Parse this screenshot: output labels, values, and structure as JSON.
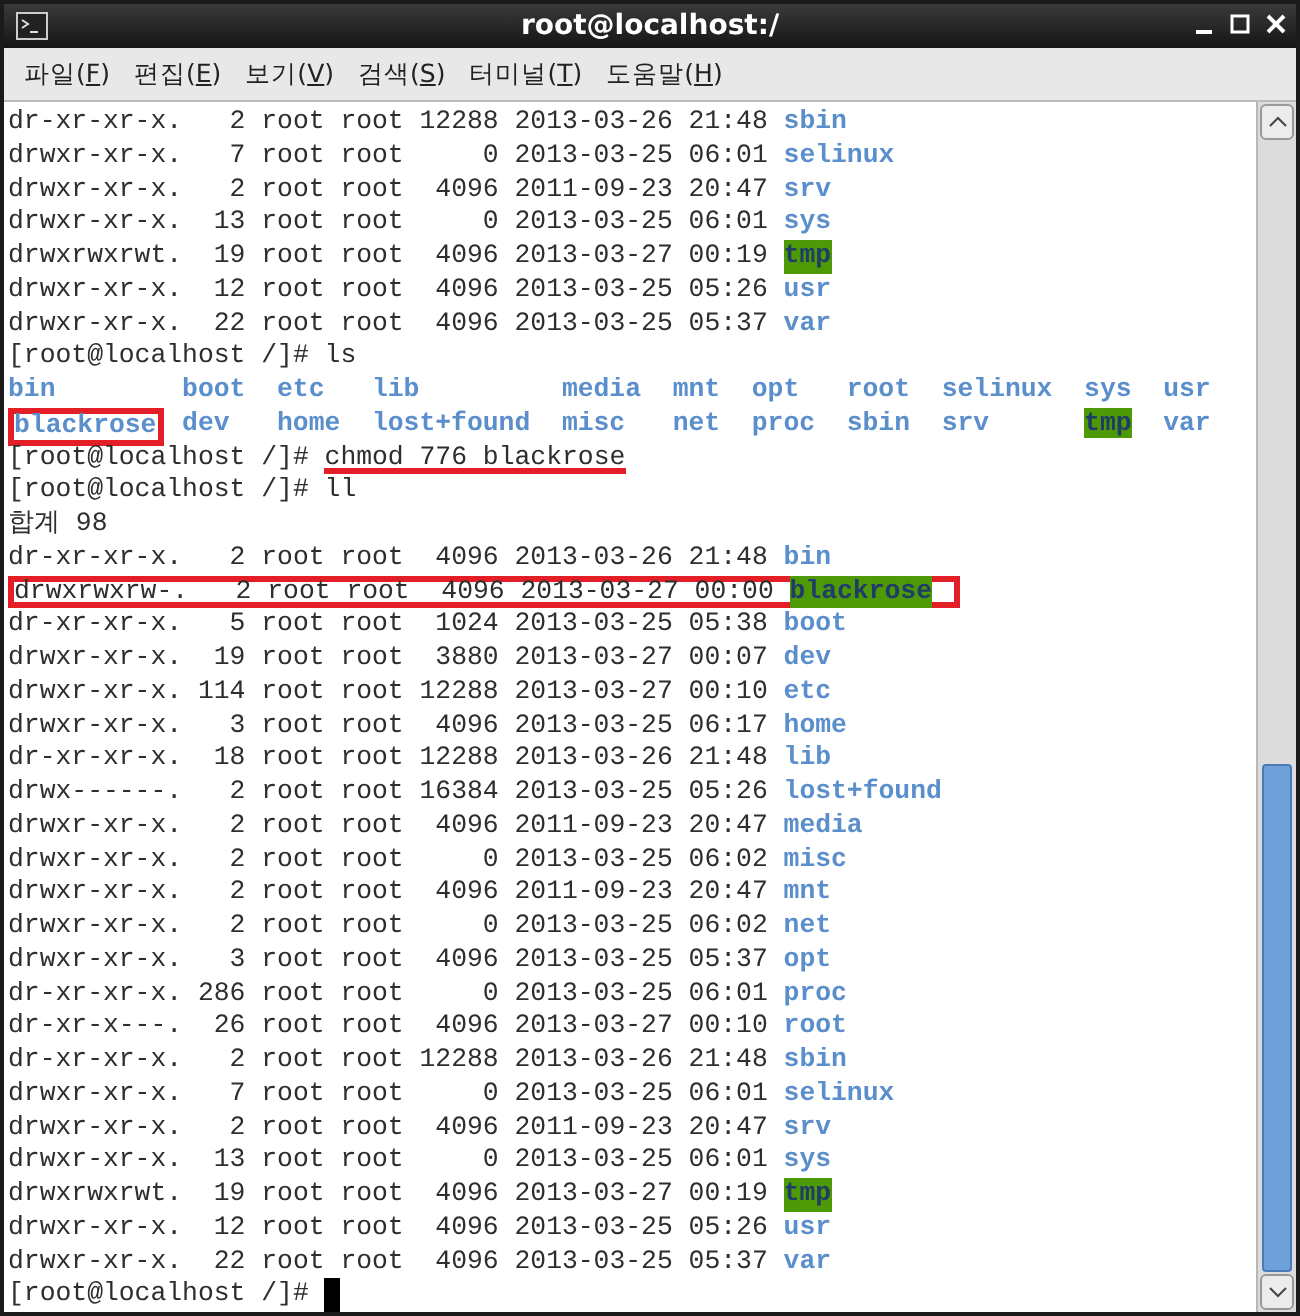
{
  "window": {
    "title": "root@localhost:/"
  },
  "menu": [
    {
      "prefix": "파일(",
      "key": "F",
      "suffix": ")"
    },
    {
      "prefix": "편집(",
      "key": "E",
      "suffix": ")"
    },
    {
      "prefix": "보기(",
      "key": "V",
      "suffix": ")"
    },
    {
      "prefix": "검색(",
      "key": "S",
      "suffix": ")"
    },
    {
      "prefix": "터미널(",
      "key": "T",
      "suffix": ")"
    },
    {
      "prefix": "도움말(",
      "key": "H",
      "suffix": ")"
    }
  ],
  "terminal": {
    "lines": [
      {
        "kind": "entry",
        "text": "dr-xr-xr-x.   2 root root 12288 2013-03-26 21:48",
        "name": "sbin",
        "highlighted": false,
        "boxed": false
      },
      {
        "kind": "entry",
        "text": "drwxr-xr-x.   7 root root     0 2013-03-25 06:01",
        "name": "selinux",
        "highlighted": false,
        "boxed": false
      },
      {
        "kind": "entry",
        "text": "drwxr-xr-x.   2 root root  4096 2011-09-23 20:47",
        "name": "srv",
        "highlighted": false,
        "boxed": false
      },
      {
        "kind": "entry",
        "text": "drwxr-xr-x.  13 root root     0 2013-03-25 06:01",
        "name": "sys",
        "highlighted": false,
        "boxed": false
      },
      {
        "kind": "entry",
        "text": "drwxrwxrwt.  19 root root  4096 2013-03-27 00:19",
        "name": "tmp",
        "highlighted": true,
        "boxed": false
      },
      {
        "kind": "entry",
        "text": "drwxr-xr-x.  12 root root  4096 2013-03-25 05:26",
        "name": "usr",
        "highlighted": false,
        "boxed": false
      },
      {
        "kind": "entry",
        "text": "drwxr-xr-x.  22 root root  4096 2013-03-25 05:37",
        "name": "var",
        "highlighted": false,
        "boxed": false
      },
      {
        "kind": "prompt",
        "prompt": "[root@localhost /]#",
        "command": "ls"
      },
      {
        "kind": "ls_row",
        "items": [
          {
            "name": "bin",
            "highlighted": false,
            "boxed": false
          },
          {
            "name": "boot",
            "highlighted": false,
            "boxed": false
          },
          {
            "name": "etc",
            "highlighted": false,
            "boxed": false
          },
          {
            "name": "lib",
            "highlighted": false,
            "boxed": false
          },
          {
            "name": "media",
            "highlighted": false,
            "boxed": false
          },
          {
            "name": "mnt",
            "highlighted": false,
            "boxed": false
          },
          {
            "name": "opt",
            "highlighted": false,
            "boxed": false
          },
          {
            "name": "root",
            "highlighted": false,
            "boxed": false
          },
          {
            "name": "selinux",
            "highlighted": false,
            "boxed": false
          },
          {
            "name": "sys",
            "highlighted": false,
            "boxed": false
          },
          {
            "name": "usr",
            "highlighted": false,
            "boxed": false
          }
        ]
      },
      {
        "kind": "ls_row",
        "items": [
          {
            "name": "blackrose",
            "highlighted": false,
            "boxed": true
          },
          {
            "name": "dev",
            "highlighted": false,
            "boxed": false
          },
          {
            "name": "home",
            "highlighted": false,
            "boxed": false
          },
          {
            "name": "lost+found",
            "highlighted": false,
            "boxed": false
          },
          {
            "name": "misc",
            "highlighted": false,
            "boxed": false
          },
          {
            "name": "net",
            "highlighted": false,
            "boxed": false
          },
          {
            "name": "proc",
            "highlighted": false,
            "boxed": false
          },
          {
            "name": "sbin",
            "highlighted": false,
            "boxed": false
          },
          {
            "name": "srv",
            "highlighted": false,
            "boxed": false
          },
          {
            "name": "tmp",
            "highlighted": true,
            "boxed": false
          },
          {
            "name": "var",
            "highlighted": false,
            "boxed": false
          }
        ]
      },
      {
        "kind": "prompt",
        "prompt": "[root@localhost /]#",
        "command": "chmod 776 blackrose",
        "underlined": true
      },
      {
        "kind": "prompt",
        "prompt": "[root@localhost /]#",
        "command": "ll"
      },
      {
        "kind": "text",
        "text": "합계 98"
      },
      {
        "kind": "entry",
        "text": "dr-xr-xr-x.   2 root root  4096 2013-03-26 21:48",
        "name": "bin",
        "highlighted": false,
        "boxed": false
      },
      {
        "kind": "entry",
        "text": "drwxrwxrw-.   2 root root  4096 2013-03-27 00:00",
        "name": "blackrose",
        "highlighted": true,
        "boxed": true
      },
      {
        "kind": "entry",
        "text": "dr-xr-xr-x.   5 root root  1024 2013-03-25 05:38",
        "name": "boot",
        "highlighted": false,
        "boxed": false
      },
      {
        "kind": "entry",
        "text": "drwxr-xr-x.  19 root root  3880 2013-03-27 00:07",
        "name": "dev",
        "highlighted": false,
        "boxed": false
      },
      {
        "kind": "entry",
        "text": "drwxr-xr-x. 114 root root 12288 2013-03-27 00:10",
        "name": "etc",
        "highlighted": false,
        "boxed": false
      },
      {
        "kind": "entry",
        "text": "drwxr-xr-x.   3 root root  4096 2013-03-25 06:17",
        "name": "home",
        "highlighted": false,
        "boxed": false
      },
      {
        "kind": "entry",
        "text": "dr-xr-xr-x.  18 root root 12288 2013-03-26 21:48",
        "name": "lib",
        "highlighted": false,
        "boxed": false
      },
      {
        "kind": "entry",
        "text": "drwx------.   2 root root 16384 2013-03-25 05:26",
        "name": "lost+found",
        "highlighted": false,
        "boxed": false
      },
      {
        "kind": "entry",
        "text": "drwxr-xr-x.   2 root root  4096 2011-09-23 20:47",
        "name": "media",
        "highlighted": false,
        "boxed": false
      },
      {
        "kind": "entry",
        "text": "drwxr-xr-x.   2 root root     0 2013-03-25 06:02",
        "name": "misc",
        "highlighted": false,
        "boxed": false
      },
      {
        "kind": "entry",
        "text": "drwxr-xr-x.   2 root root  4096 2011-09-23 20:47",
        "name": "mnt",
        "highlighted": false,
        "boxed": false
      },
      {
        "kind": "entry",
        "text": "drwxr-xr-x.   2 root root     0 2013-03-25 06:02",
        "name": "net",
        "highlighted": false,
        "boxed": false
      },
      {
        "kind": "entry",
        "text": "drwxr-xr-x.   3 root root  4096 2013-03-25 05:37",
        "name": "opt",
        "highlighted": false,
        "boxed": false
      },
      {
        "kind": "entry",
        "text": "dr-xr-xr-x. 286 root root     0 2013-03-25 06:01",
        "name": "proc",
        "highlighted": false,
        "boxed": false
      },
      {
        "kind": "entry",
        "text": "dr-xr-x---.  26 root root  4096 2013-03-27 00:10",
        "name": "root",
        "highlighted": false,
        "boxed": false
      },
      {
        "kind": "entry",
        "text": "dr-xr-xr-x.   2 root root 12288 2013-03-26 21:48",
        "name": "sbin",
        "highlighted": false,
        "boxed": false
      },
      {
        "kind": "entry",
        "text": "drwxr-xr-x.   7 root root     0 2013-03-25 06:01",
        "name": "selinux",
        "highlighted": false,
        "boxed": false
      },
      {
        "kind": "entry",
        "text": "drwxr-xr-x.   2 root root  4096 2011-09-23 20:47",
        "name": "srv",
        "highlighted": false,
        "boxed": false
      },
      {
        "kind": "entry",
        "text": "drwxr-xr-x.  13 root root     0 2013-03-25 06:01",
        "name": "sys",
        "highlighted": false,
        "boxed": false
      },
      {
        "kind": "entry",
        "text": "drwxrwxrwt.  19 root root  4096 2013-03-27 00:19",
        "name": "tmp",
        "highlighted": true,
        "boxed": false
      },
      {
        "kind": "entry",
        "text": "drwxr-xr-x.  12 root root  4096 2013-03-25 05:26",
        "name": "usr",
        "highlighted": false,
        "boxed": false
      },
      {
        "kind": "entry",
        "text": "drwxr-xr-x.  22 root root  4096 2013-03-25 05:37",
        "name": "var",
        "highlighted": false,
        "boxed": false
      },
      {
        "kind": "prompt",
        "prompt": "[root@localhost /]#",
        "cursor": true
      }
    ]
  }
}
